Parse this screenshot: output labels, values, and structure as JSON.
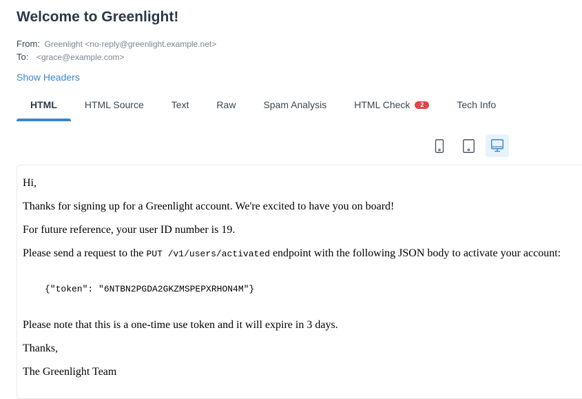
{
  "email": {
    "subject": "Welcome to Greenlight!",
    "from_label": "From:",
    "from_value": "Greenlight <no-reply@greenlight.example.net>",
    "to_label": "To:",
    "to_value": "<grace@example.com>",
    "show_headers": "Show Headers"
  },
  "tabs": [
    {
      "label": "HTML",
      "active": true
    },
    {
      "label": "HTML Source"
    },
    {
      "label": "Text"
    },
    {
      "label": "Raw"
    },
    {
      "label": "Spam Analysis"
    },
    {
      "label": "HTML Check",
      "badge": "2"
    },
    {
      "label": "Tech Info"
    }
  ],
  "device_views": [
    {
      "icon": "mobile-icon"
    },
    {
      "icon": "tablet-icon"
    },
    {
      "icon": "desktop-icon",
      "active": true
    }
  ],
  "body": {
    "greeting": "Hi,",
    "line1": "Thanks for signing up for a Greenlight account. We're excited to have you on board!",
    "line2": "For future reference, your user ID number is 19.",
    "line3_before": "Please send a request to the ",
    "line3_code": "PUT /v1/users/activated",
    "line3_after": " endpoint with the following JSON body to activate your account:",
    "json_body": "{\"token\": \"6NTBN2PGDA2GKZMSPEPXRHON4M\"}",
    "line4": "Please note that this is a one-time use token and it will expire in 3 days.",
    "signoff": "Thanks,",
    "signature": "The Greenlight Team"
  },
  "colors": {
    "accent": "#3a86c9",
    "badge": "#e04444",
    "text": "#2c3845"
  }
}
